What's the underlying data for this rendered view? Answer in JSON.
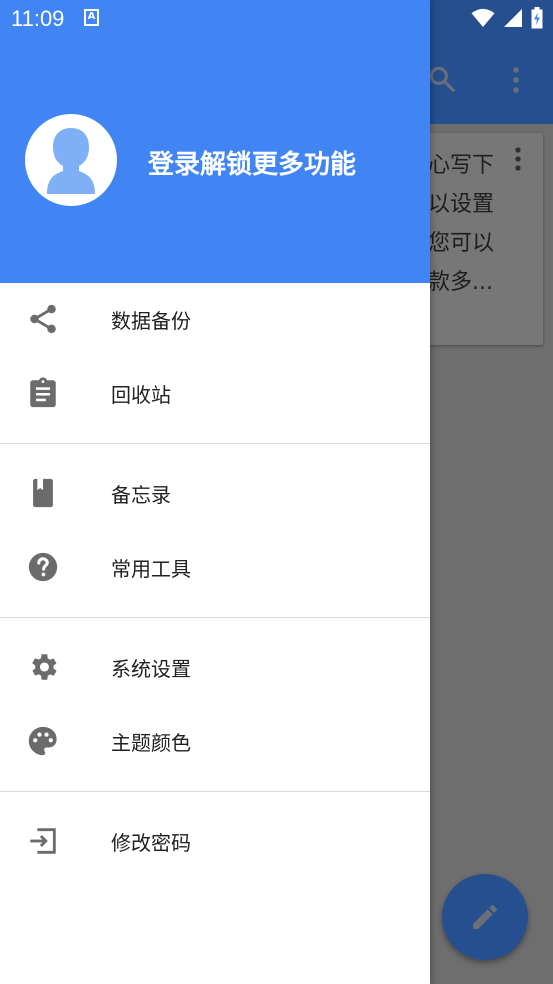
{
  "status_bar": {
    "time": "11:09",
    "notification_icon": "a-box-icon",
    "icons": [
      "wifi-icon",
      "signal-icon",
      "battery-charging-icon"
    ]
  },
  "background_app": {
    "toolbar_icons": [
      "search-icon",
      "more-vert-icon"
    ],
    "card_text": "心写下\n以设置\n您可以\n款多...",
    "fab_icon": "pencil-icon",
    "colors": {
      "toolbar": "#264f8f",
      "scrim": "#6e6e6e"
    }
  },
  "drawer": {
    "header": {
      "title": "登录解锁更多功能",
      "avatar_icon": "person-avatar-icon",
      "color": "#4185f5"
    },
    "groups": [
      [
        {
          "label": "数据备份",
          "icon": "share-icon"
        },
        {
          "label": "回收站",
          "icon": "clipboard-icon"
        }
      ],
      [
        {
          "label": "备忘录",
          "icon": "book-icon"
        },
        {
          "label": "常用工具",
          "icon": "help-circle-icon"
        }
      ],
      [
        {
          "label": "系统设置",
          "icon": "gear-icon"
        },
        {
          "label": "主题颜色",
          "icon": "palette-icon"
        }
      ],
      [
        {
          "label": "修改密码",
          "icon": "exit-to-app-icon"
        }
      ]
    ]
  }
}
